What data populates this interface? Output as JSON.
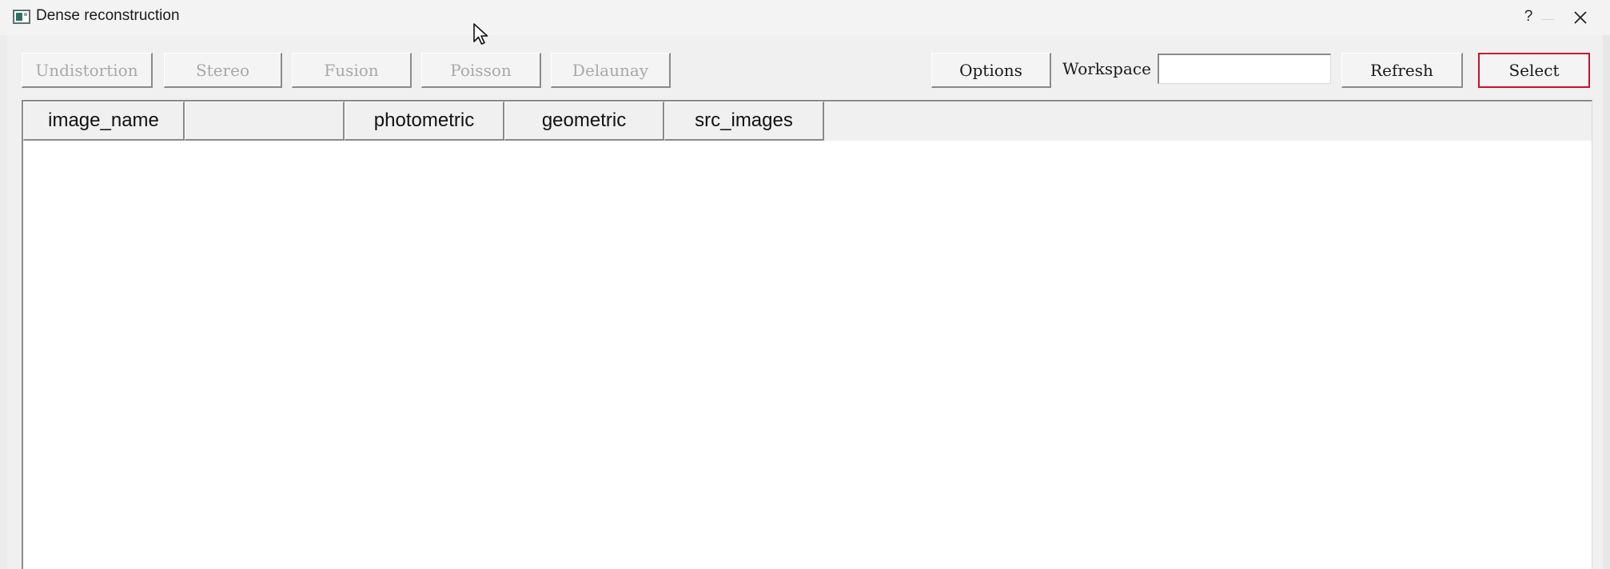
{
  "window": {
    "title": "Dense reconstruction",
    "help_label": "?"
  },
  "toolbar": {
    "undistortion": "Undistortion",
    "stereo": "Stereo",
    "fusion": "Fusion",
    "poisson": "Poisson",
    "delaunay": "Delaunay",
    "options": "Options",
    "workspace_label": "Workspace",
    "workspace_value": "",
    "refresh": "Refresh",
    "select": "Select"
  },
  "table": {
    "columns": [
      "image_name",
      "",
      "photometric",
      "geometric",
      "src_images"
    ],
    "rows": []
  },
  "colors": {
    "focus_border": "#c8102e",
    "disabled_text": "#a8a8a8"
  }
}
